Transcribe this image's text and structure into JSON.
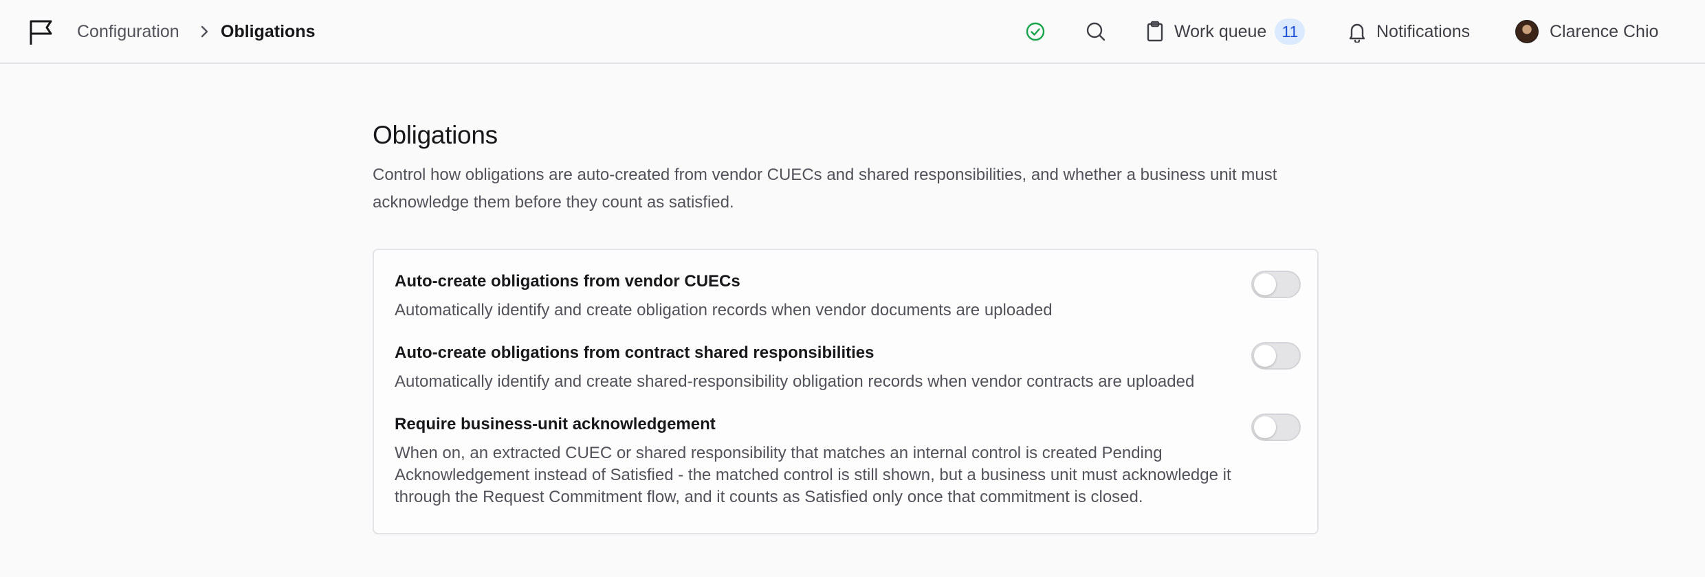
{
  "header": {
    "logo_icon": "flag-icon",
    "breadcrumb": {
      "parent": "Configuration",
      "separator_icon": "chevron-right-icon",
      "current": "Obligations"
    },
    "status_icon": "check-circle-icon",
    "status_color": "#16a34a",
    "search_icon": "search-icon",
    "work_queue": {
      "label": "Work queue",
      "icon": "clipboard-icon",
      "count": "11"
    },
    "notifications": {
      "label": "Notifications",
      "icon": "bell-icon"
    },
    "user": {
      "name": "Clarence Chio",
      "icon": "avatar"
    }
  },
  "main": {
    "title": "Obligations",
    "description": "Control how obligations are auto-created from vendor CUECs and shared responsibilities, and whether a business unit must acknowledge them before they count as satisfied.",
    "settings": [
      {
        "title": "Auto-create obligations from vendor CUECs",
        "description": "Automatically identify and create obligation records when vendor documents are uploaded",
        "enabled": false
      },
      {
        "title": "Auto-create obligations from contract shared responsibilities",
        "description": "Automatically identify and create shared-responsibility obligation records when vendor contracts are uploaded",
        "enabled": false
      },
      {
        "title": "Require business-unit acknowledgement",
        "description": "When on, an extracted CUEC or shared responsibility that matches an internal control is created Pending Acknowledgement instead of Satisfied - the matched control is still shown, but a business unit must acknowledge it through the Request Commitment flow, and it counts as Satisfied only once that commitment is closed.",
        "enabled": false
      }
    ]
  },
  "colors": {
    "badge_bg": "#dbeafe",
    "badge_text": "#1d4ed8",
    "toggle_off": "#e4e4e7"
  }
}
